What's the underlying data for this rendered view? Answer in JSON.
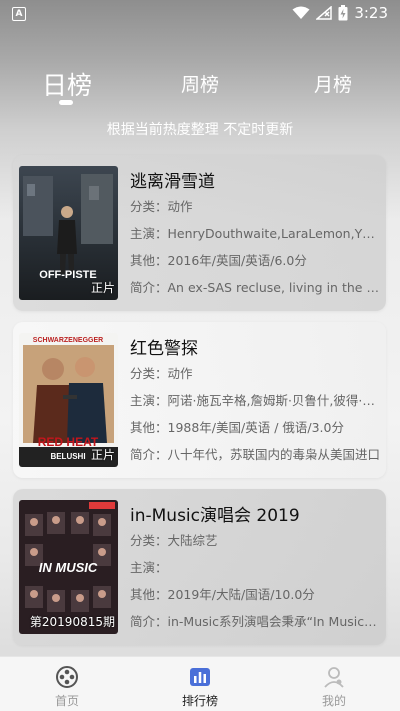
{
  "status_bar": {
    "time": "3:23",
    "app_icon": "A",
    "icons": [
      "wifi-icon",
      "no-signal-icon",
      "battery-charging-icon"
    ]
  },
  "tabs": [
    {
      "label": "日榜",
      "active": true
    },
    {
      "label": "周榜",
      "active": false
    },
    {
      "label": "月榜",
      "active": false
    }
  ],
  "subtitle": "根据当前热度整理 不定时更新",
  "movies": [
    {
      "title": "逃离滑雪道",
      "category": "分类：动作",
      "cast": "主演：HenryDouthwaite,LaraLemon,Yvonne",
      "other": "其他：2016年/英国/英语/6.0分",
      "intro": "简介：An ex-SAS recluse, living in the mountains",
      "badge": "正片",
      "poster_text": "OFF-PISTE"
    },
    {
      "title": "红色警探",
      "category": "分类：动作",
      "cast": "主演：阿诺·施瓦辛格,詹姆斯·贝鲁什,彼得·波尔",
      "other": "其他：1988年/美国/英语 / 俄语/3.0分",
      "intro": "简介：八十年代，苏联国内的毒枭从美国进口",
      "badge": "正片",
      "poster_text": "RED HEAT",
      "poster_top_text": "SCHWARZENEGGER",
      "poster_bottom_text": "BELUSHI"
    },
    {
      "title": "in-Music演唱会 2019",
      "category": "分类：大陆综艺",
      "cast": "主演：",
      "other": "其他：2019年/大陆/国语/10.0分",
      "intro": "简介：in-Music系列演唱会秉承“In Music”的理念",
      "badge": "第20190815期",
      "poster_text": "IN MUSIC"
    }
  ],
  "bottom_nav": [
    {
      "label": "首页",
      "icon": "film-reel-icon",
      "active": false
    },
    {
      "label": "排行榜",
      "icon": "bar-chart-icon",
      "active": true
    },
    {
      "label": "我的",
      "icon": "user-icon",
      "active": false
    }
  ],
  "colors": {
    "accent": "#4a6fd8",
    "text_primary": "#111111",
    "text_secondary": "#666666"
  }
}
